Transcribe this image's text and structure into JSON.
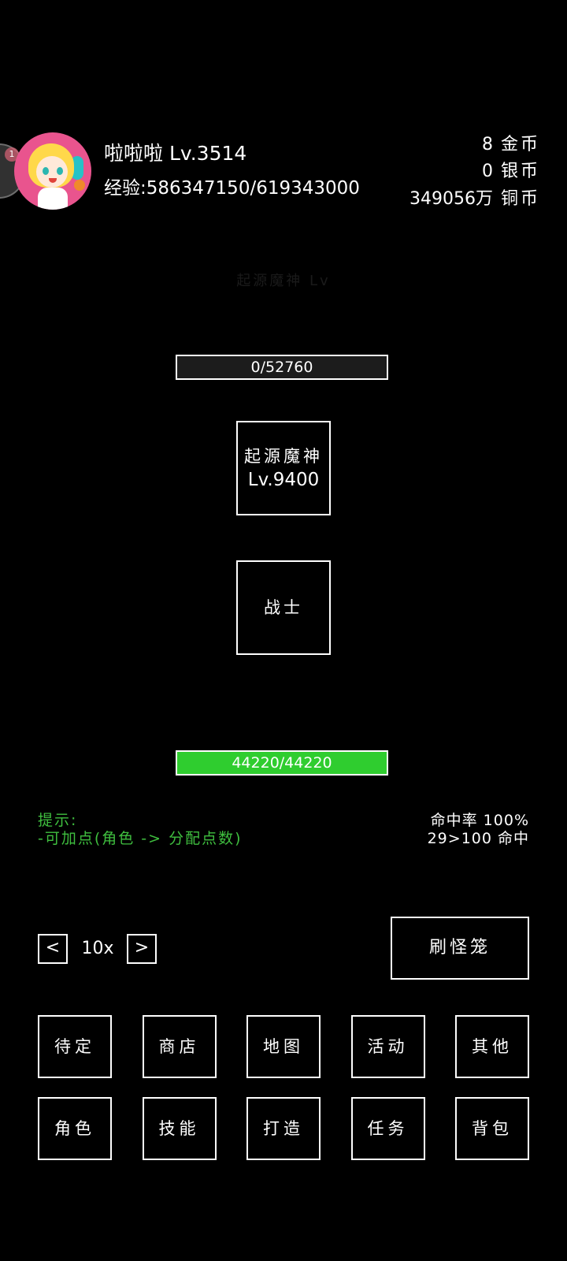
{
  "player": {
    "name_level": "啦啦啦 Lv.3514",
    "exp_text": "经验:586347150/619343000"
  },
  "overlay": {
    "badge": "1"
  },
  "currency": {
    "gold": {
      "amount": "8",
      "unit": "金币"
    },
    "silver": {
      "amount": "0",
      "unit": "银币"
    },
    "copper": {
      "amount": "349056万",
      "unit": "铜币"
    }
  },
  "battle": {
    "faint_title": "起源魔神 Lv",
    "enemy_hp_text": "0/52760",
    "enemy_hp_fraction": 0,
    "enemy_name": "起源魔神",
    "enemy_level": "Lv.9400",
    "player_unit": "战士",
    "player_hp_text": "44220/44220",
    "player_hp_fraction": 1.0
  },
  "tips": {
    "title": "提示:",
    "line1": "-可加点(角色 -> 分配点数)"
  },
  "stats": {
    "hit_rate": "命中率 100%",
    "hit_line": "29>100 命中"
  },
  "speed": {
    "prev": "<",
    "value": "10x",
    "next": ">"
  },
  "cage_button": "刷怪笼",
  "menu": [
    "待定",
    "商店",
    "地图",
    "活动",
    "其他",
    "角色",
    "技能",
    "打造",
    "任务",
    "背包"
  ],
  "colors": {
    "hp_green": "#2fcd2f",
    "tip_green": "#3fbf3f"
  }
}
